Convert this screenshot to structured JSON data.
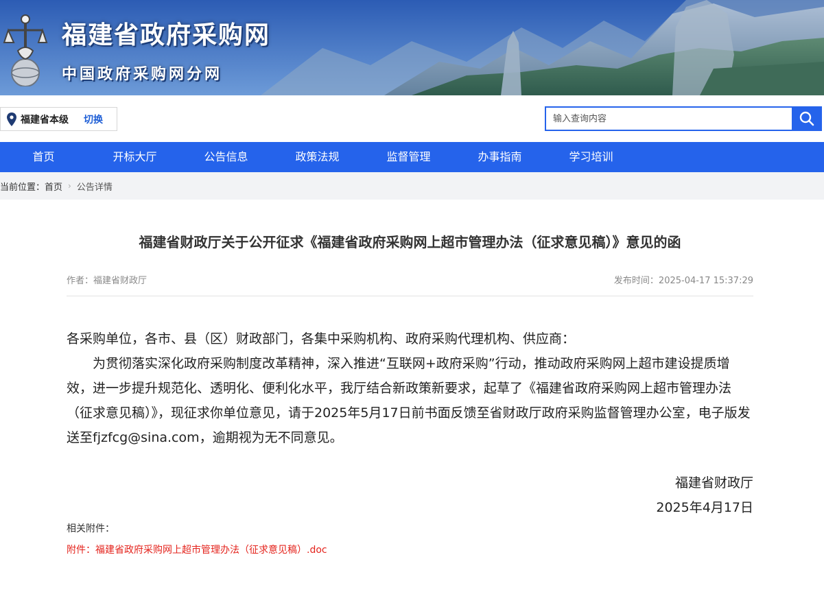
{
  "header": {
    "site_title": "福建省政府采购网",
    "site_subtitle": "中国政府采购网分网",
    "logo_icon": "scales-of-justice-globe-icon"
  },
  "region": {
    "icon": "location-pin-icon",
    "level": "福建省本级",
    "switch_label": "切换"
  },
  "search": {
    "placeholder": "输入查询内容",
    "value": "",
    "icon": "search-icon"
  },
  "nav": {
    "items": [
      "首页",
      "开标大厅",
      "公告信息",
      "政策法规",
      "监督管理",
      "办事指南",
      "学习培训"
    ]
  },
  "breadcrumb": {
    "prefix": "当前位置：",
    "home": "首页",
    "separator_icon": "chevron-right-icon",
    "current": "公告详情"
  },
  "article": {
    "title": "福建省财政厅关于公开征求《福建省政府采购网上超市管理办法（征求意见稿）》意见的函",
    "author": "作者：福建省财政厅",
    "publish_time": "发布时间：2025-04-17 15:37:29",
    "salutation": "各采购单位，各市、县（区）财政部门，各集中采购机构、政府采购代理机构、供应商：",
    "paragraph": "为贯彻落实深化政府采购制度改革精神，深入推进“互联网+政府采购”行动，推动政府采购网上超市建设提质增效，进一步提升规范化、透明化、便利化水平，我厅结合新政策新要求，起草了《福建省政府采购网上超市管理办法（征求意见稿）》，现征求你单位意见，请于2025年5月17日前书面反馈至省财政厅政府采购监督管理办公室，电子版发送至fjzfcg@sina.com，逾期视为无不同意见。",
    "signature_org": "福建省财政厅",
    "signature_date": "2025年4月17日",
    "attachments_label": "相关附件：",
    "attachment_link": "附件：福建省政府采购网上超市管理办法（征求意见稿）.doc"
  },
  "colors": {
    "primary_blue": "#2563eb",
    "attachment_red": "#e4231c",
    "breadcrumb_bg": "#f2f3f5"
  }
}
